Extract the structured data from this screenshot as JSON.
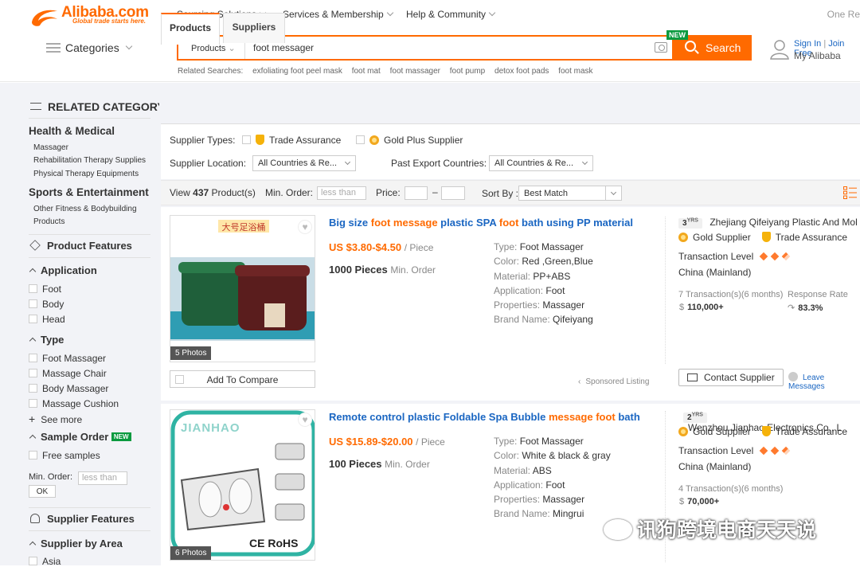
{
  "header": {
    "logo_word": "Alibaba.com",
    "logo_tagline": "Global trade starts here.",
    "nav": [
      "Sourcing Solutions",
      "Services & Membership",
      "Help & Community"
    ],
    "right_truncated": "One Re",
    "categories_label": "Categories",
    "search": {
      "category": "Products",
      "value": "foot messager",
      "button": "Search",
      "new_badge": "NEW"
    },
    "signin": "Sign In",
    "join_free": "Join Free",
    "my_alibaba": "My Alibaba",
    "related_label": "Related Searches:",
    "related": [
      "exfoliating foot peel mask",
      "foot mat",
      "foot massager",
      "foot pump",
      "detox foot pads",
      "foot mask"
    ]
  },
  "sidebar": {
    "related_title": "RELATED CATEGORY",
    "groups": [
      {
        "title": "Health & Medical",
        "items": [
          "Massager",
          "Rehabilitation Therapy Supplies",
          "Physical Therapy Equipments"
        ]
      },
      {
        "title": "Sports & Entertainment",
        "items": [
          "Other Fitness & Bodybuilding",
          "Products"
        ]
      }
    ],
    "product_features": "Product Features",
    "application": {
      "title": "Application",
      "items": [
        "Foot",
        "Body",
        "Head"
      ]
    },
    "type": {
      "title": "Type",
      "items": [
        "Foot Massager",
        "Massage Chair",
        "Body Massager",
        "Massage Cushion"
      ],
      "see_more": "See more"
    },
    "sample_order": {
      "title": "Sample Order",
      "badge": "NEW",
      "item": "Free samples"
    },
    "min_order_label": "Min. Order:",
    "min_order_placeholder": "less than",
    "ok": "OK",
    "supplier_features": "Supplier Features",
    "supplier_by_area": {
      "title": "Supplier by Area",
      "item": "Asia"
    }
  },
  "tabs": [
    "Products",
    "Suppliers"
  ],
  "filters": {
    "supplier_types_label": "Supplier Types:",
    "trade_assurance": "Trade Assurance",
    "gold_plus": "Gold Plus Supplier",
    "supplier_location_label": "Supplier Location:",
    "supplier_location_value": "All Countries & Re...",
    "past_export_label": "Past Export Countries:",
    "past_export_value": "All Countries & Re..."
  },
  "viewbar": {
    "view_prefix": "View",
    "count": "437",
    "view_suffix": "Product(s)",
    "min_order_label": "Min. Order:",
    "min_order_placeholder": "less than",
    "price_label": "Price:",
    "dash": "–",
    "sort_label": "Sort By :",
    "sort_value": "Best Match"
  },
  "products": [
    {
      "title_parts": [
        "Big size ",
        "foot message",
        " plastic SPA ",
        "foot",
        " bath using PP material"
      ],
      "price": "US $3.80-$4.50",
      "price_unit": "/ Piece",
      "moq": "1000 Pieces",
      "moq_unit": "Min. Order",
      "photos": "5 Photos",
      "image_caption": "大号足浴桶",
      "attrs": [
        {
          "k": "Type:",
          "v": "Foot Massager"
        },
        {
          "k": "Color:",
          "v": "Red ,Green,Blue"
        },
        {
          "k": "Material:",
          "v": "PP+ABS"
        },
        {
          "k": "Application:",
          "v": "Foot"
        },
        {
          "k": "Properties:",
          "v": "Massager"
        },
        {
          "k": "Brand Name:",
          "v": "Qifeiyang"
        }
      ],
      "years": "3",
      "yrs_unit": "YRS",
      "supplier": "Zhejiang Qifeiyang Plastic And Mol",
      "gold": "Gold Supplier",
      "ta": "Trade Assurance",
      "transaction_level": "Transaction Level",
      "country": "China (Mainland)",
      "transactions_label": "7 Transaction(s)(6 months)",
      "transactions_value": "110,000+",
      "response_label": "Response Rate",
      "response_value": "83.3%",
      "compare": "Add To Compare",
      "sponsored": "Sponsored Listing",
      "contact": "Contact Supplier",
      "leave": "Leave Messages"
    },
    {
      "title_parts": [
        "Remote control plastic Foldable Spa Bubble ",
        "message foot",
        " bath"
      ],
      "price": "US $15.89-$20.00",
      "price_unit": "/ Piece",
      "moq": "100 Pieces",
      "moq_unit": "Min. Order",
      "photos": "6 Photos",
      "image_caption": "JIANHAO",
      "image_cert": "CE RoHS",
      "attrs": [
        {
          "k": "Type:",
          "v": "Foot Massager"
        },
        {
          "k": "Color:",
          "v": "White & black & gray"
        },
        {
          "k": "Material:",
          "v": "ABS"
        },
        {
          "k": "Application:",
          "v": "Foot"
        },
        {
          "k": "Properties:",
          "v": "Massager"
        },
        {
          "k": "Brand Name:",
          "v": "Mingrui"
        }
      ],
      "years": "2",
      "yrs_unit": "YRS",
      "supplier": "Wenzhou Jianhao Electronics Co., L",
      "gold": "Gold Supplier",
      "ta": "Trade Assurance",
      "transaction_level": "Transaction Level",
      "country": "China (Mainland)",
      "transactions_label": "4 Transaction(s)(6 months)",
      "transactions_value": "70,000+"
    }
  ],
  "watermark": "讯狗跨境电商天天说",
  "colors": {
    "accent": "#ff6a00",
    "link": "#1a66c2",
    "new_badge": "#0a9a3f"
  }
}
